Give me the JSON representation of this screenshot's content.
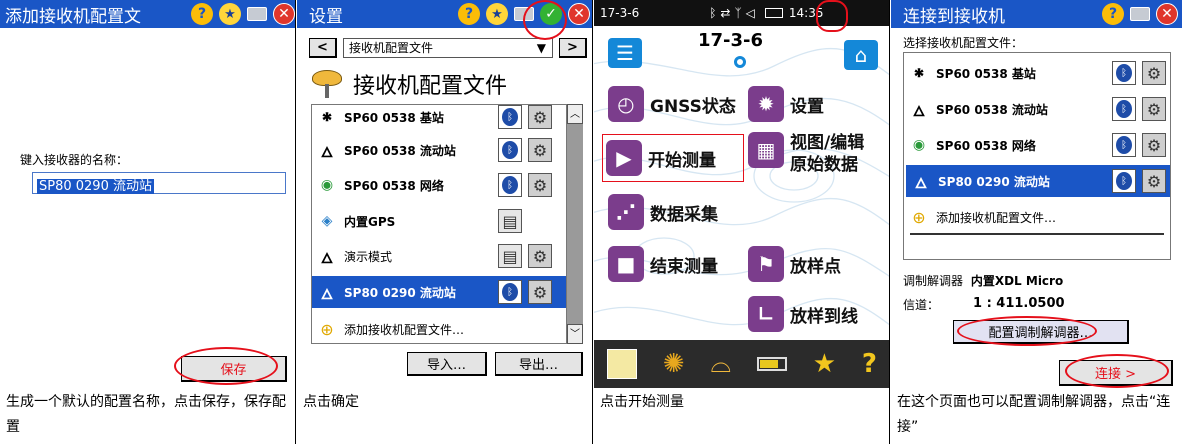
{
  "panel1": {
    "title": "添加接收机配置文",
    "label": "键入接收器的名称：",
    "input_value": "SP80 0290 流动站",
    "save": "保存",
    "caption": "生成一个默认的配置名称，点击保存，保存配置"
  },
  "panel2": {
    "title": "设置",
    "dropdown": "接收机配置文件",
    "header": "接收机配置文件",
    "items": [
      {
        "label": "SP60 0538 基站",
        "icon": "base-icon"
      },
      {
        "label": "SP60 0538 流动站",
        "icon": "rover-icon"
      },
      {
        "label": "SP60 0538 网络",
        "icon": "network-icon"
      },
      {
        "label": "内置GPS",
        "icon": "internal-gps-icon"
      },
      {
        "label": "演示模式",
        "icon": "demo-icon"
      },
      {
        "label": "SP80 0290 流动站",
        "icon": "rover-icon"
      }
    ],
    "add": "添加接收机配置文件…",
    "import": "导入…",
    "export": "导出…",
    "caption": "点击确定",
    "nav_prev": "<",
    "nav_next": ">"
  },
  "panel3": {
    "status_date": "17-3-6",
    "center_date": "17-3-6",
    "time": "14:35",
    "tiles": [
      {
        "label": "GNSS状态"
      },
      {
        "label": "设置"
      },
      {
        "label": "开始测量"
      },
      {
        "label": "视图/编辑\n原始数据"
      },
      {
        "label": "数据采集"
      },
      {
        "label": "结束测量"
      },
      {
        "label": "放样点"
      },
      {
        "label": "放样到线"
      }
    ],
    "caption": "点击开始测量"
  },
  "panel4": {
    "title": "连接到接收机",
    "label": "选择接收机配置文件：",
    "items": [
      "SP60 0538 基站",
      "SP60 0538 流动站",
      "SP60 0538 网络",
      "SP80 0290 流动站"
    ],
    "add": "添加接收机配置文件…",
    "modem_label": "调制解调器",
    "modem_value": "内置XDL Micro",
    "channel_label": "信道：",
    "channel_value": "1 : 411.0500",
    "config_modem": "配置调制解调器…",
    "connect": "连接 >",
    "caption": "在这个页面也可以配置调制解调器，点击“连接”"
  },
  "colors": {
    "title_blue": "#1a56c6",
    "selected_blue": "#1a56c6",
    "ring_red": "#e5101b",
    "tile_purple": "#7b3d8c",
    "home_blue": "#1488d8"
  }
}
